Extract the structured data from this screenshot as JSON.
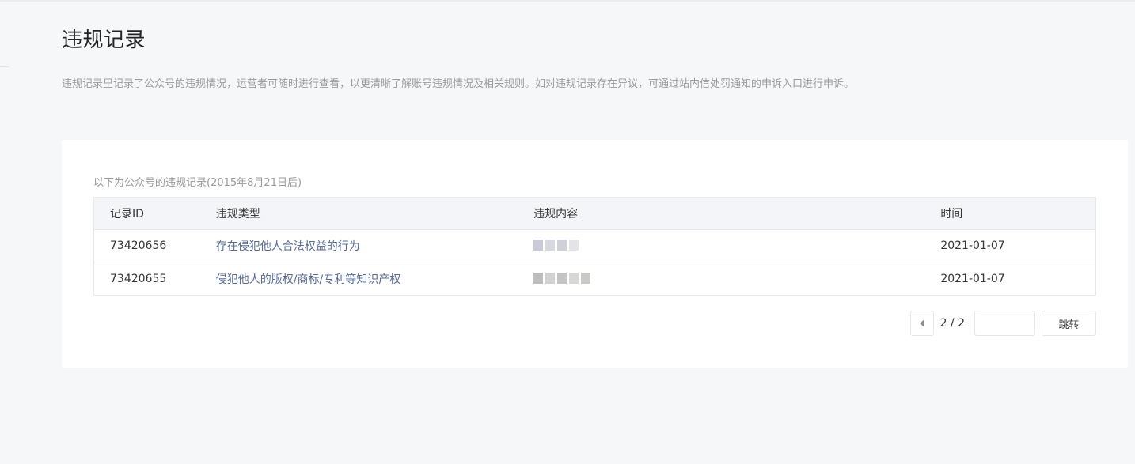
{
  "page": {
    "title": "违规记录",
    "description": "违规记录里记录了公众号的违规情况，运营者可随时进行查看，以更清晰了解账号违规情况及相关规则。如对违规记录存在异议，可通过站内信处罚通知的申诉入口进行申诉。"
  },
  "table": {
    "caption": "以下为公众号的违规记录(2015年8月21日后)",
    "headers": [
      "记录ID",
      "违规类型",
      "违规内容",
      "时间"
    ],
    "rows": [
      {
        "id": "73420656",
        "type": "存在侵犯他人合法权益的行为",
        "content_redacted": true,
        "time": "2021-01-07"
      },
      {
        "id": "73420655",
        "type": "侵犯他人的版权/商标/专利等知识产权",
        "content_redacted": true,
        "time": "2021-01-07"
      }
    ]
  },
  "pagination": {
    "indicator": "2 / 2",
    "input_value": "",
    "jump_label": "跳转"
  },
  "colors": {
    "link": "#576b95",
    "background": "#f6f7f9"
  }
}
